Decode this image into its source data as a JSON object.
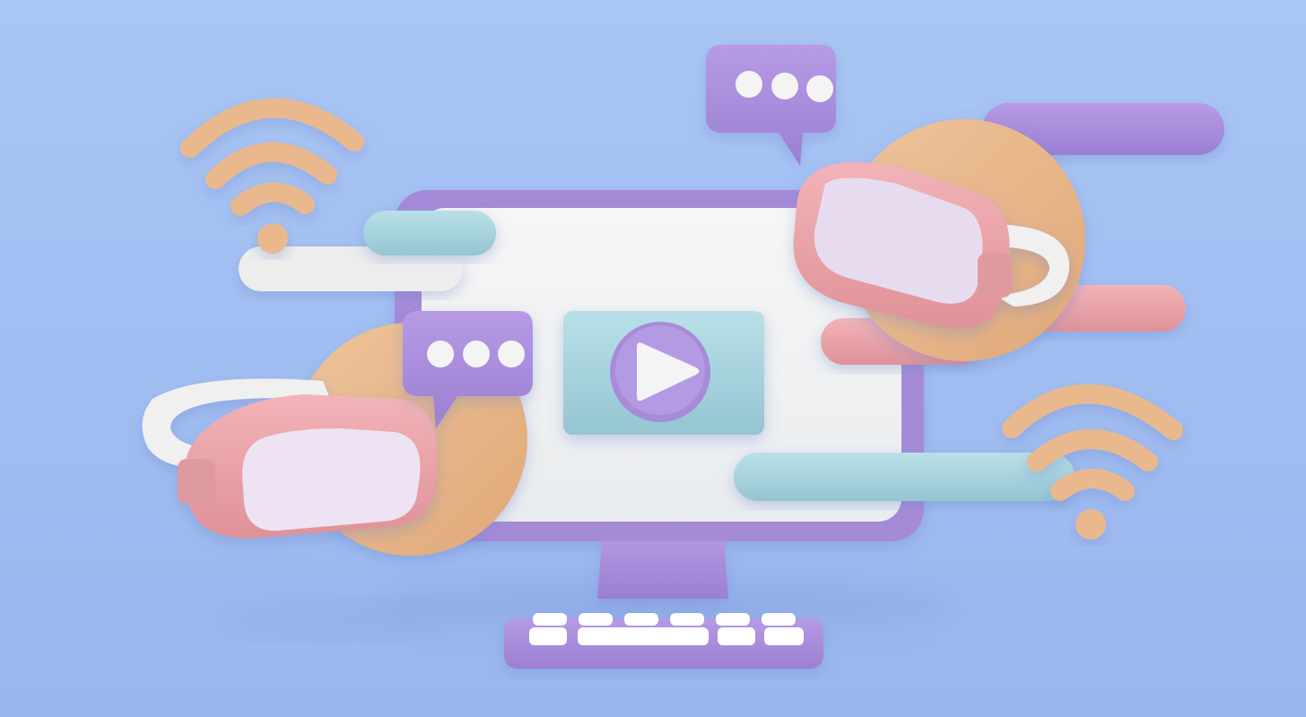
{
  "scene": {
    "description_free": true,
    "palette": {
      "background_top": "#a9c6f4",
      "background_bottom": "#9ab6ee",
      "monitor_frame": "#a58ad8",
      "monitor_screen": "#f2f3f3",
      "video_panel": "#a9d3de",
      "play_circle": "#a88bd8",
      "peach": "#e9b98d",
      "pink": "#e9a3aa",
      "blue_pill": "#a7d2dd",
      "lavender_pill": "#a98bd8",
      "white_pill": "#eeeeee",
      "keyboard_base": "#a98bd8",
      "keys": "#ffffff"
    },
    "icons": [
      "wifi-icon",
      "chat-bubble-icon",
      "vr-headset-icon",
      "play-icon",
      "monitor-icon",
      "keyboard-icon"
    ]
  }
}
